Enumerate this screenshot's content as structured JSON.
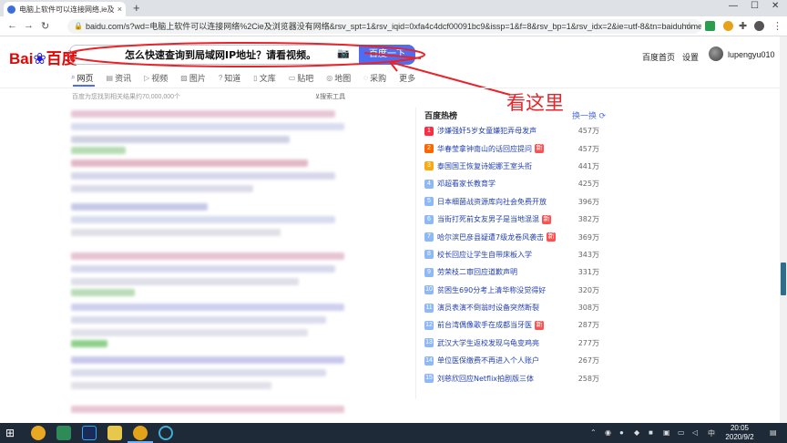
{
  "browser": {
    "tab_title": "电脑上软件可以连接网络,ie及浏览",
    "tab_close": "×",
    "new_tab": "+",
    "url": "baidu.com/s?wd=电脑上软件可以连接网络%2Cie及浏览器没有网络&rsv_spt=1&rsv_iqid=0xfa4c4dcf00091bc9&issp=1&f=8&rsv_bp=1&rsv_idx=2&ie=utf-8&tn=baiduhome_pg",
    "min": "—",
    "max": "☐",
    "close": "✕"
  },
  "header": {
    "logo_bai": "Bai",
    "logo_du": "du",
    "logo_cn": "百度",
    "search_value": "怎么快速查询到局域网IP地址？请看视频。",
    "search_button": "百度一下",
    "link_home": "百度首页",
    "link_settings": "设置",
    "username": "lupengyu010"
  },
  "annotation": {
    "text": "看这里",
    "color": "#e8242a"
  },
  "tabs": [
    {
      "label": "网页",
      "icon": "search-icon"
    },
    {
      "label": "资讯",
      "icon": "news-icon"
    },
    {
      "label": "视频",
      "icon": "video-icon"
    },
    {
      "label": "图片",
      "icon": "image-icon"
    },
    {
      "label": "知道",
      "icon": "qa-icon"
    },
    {
      "label": "文库",
      "icon": "doc-icon"
    },
    {
      "label": "贴吧",
      "icon": "forum-icon"
    },
    {
      "label": "地图",
      "icon": "map-icon"
    },
    {
      "label": "采购",
      "icon": "cart-icon"
    },
    {
      "label": "更多",
      "icon": ""
    }
  ],
  "result_count": "百度为您找到相关结果约70,000,000个",
  "search_tools": "搜索工具",
  "hot": {
    "title": "百度热榜",
    "refresh": "换一换",
    "items": [
      {
        "rank": "1",
        "title": "涉嫌强奸5岁女童嫌犯弄母发声",
        "heat": "457万",
        "new": false
      },
      {
        "rank": "2",
        "title": "华春莹拿钟南山的话回应提问",
        "heat": "457万",
        "new": true
      },
      {
        "rank": "3",
        "title": "泰国国王恢复诗妮娜王室头衔",
        "heat": "441万",
        "new": false
      },
      {
        "rank": "4",
        "title": "邓超看家长教育学",
        "heat": "425万",
        "new": false
      },
      {
        "rank": "5",
        "title": "日本细菌战资源库向社会免费开放",
        "heat": "396万",
        "new": false
      },
      {
        "rank": "6",
        "title": "当街打死前女友男子是当地混混",
        "heat": "382万",
        "new": true
      },
      {
        "rank": "7",
        "title": "哈尔滨巴彦县疑遭7级龙卷风袭击",
        "heat": "369万",
        "new": true
      },
      {
        "rank": "8",
        "title": "校长回应让学生自带床板入学",
        "heat": "343万",
        "new": false
      },
      {
        "rank": "9",
        "title": "劳荣枝二审回应道歉声明",
        "heat": "331万",
        "new": false
      },
      {
        "rank": "10",
        "title": "贫困生690分考上清华称没觉得好",
        "heat": "320万",
        "new": false
      },
      {
        "rank": "11",
        "title": "演员表演不倒翁时设备突然断裂",
        "heat": "308万",
        "new": false
      },
      {
        "rank": "12",
        "title": "前台湾偶像歌手在成都当牙医",
        "heat": "287万",
        "new": true
      },
      {
        "rank": "13",
        "title": "武汉大学生返校发现乌龟变鸡亮",
        "heat": "277万",
        "new": false
      },
      {
        "rank": "14",
        "title": "单位医保缴费不再进入个人账户",
        "heat": "267万",
        "new": false
      },
      {
        "rank": "15",
        "title": "刘慈欣回应Netflix拍剧版三体",
        "heat": "258万",
        "new": false
      }
    ],
    "new_label": "新",
    "rank_colors": {
      "top1": "#fe2d46",
      "top2": "#f60",
      "top3": "#faa90e",
      "rest": "#8eb9f5"
    }
  },
  "taskbar": {
    "time": "20:05",
    "date": "2020/9/2",
    "ime": "中"
  },
  "colors": {
    "accent": "#4e6ef2",
    "logo_red": "#e10602",
    "logo_blue": "#2319dc"
  }
}
